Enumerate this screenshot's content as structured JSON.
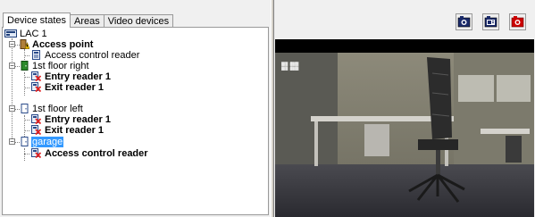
{
  "tabs": [
    {
      "label": "Device states",
      "active": true
    },
    {
      "label": "Areas",
      "active": false
    },
    {
      "label": "Video devices",
      "active": false
    }
  ],
  "tree": {
    "root": "LAC 1",
    "nodes": [
      {
        "label": "Access point",
        "bold": true,
        "icon": "warning-door-icon",
        "expander": "minus",
        "children": [
          {
            "label": "Access control reader",
            "bold": false,
            "icon": "reader-icon"
          }
        ]
      },
      {
        "label": "1st floor right",
        "bold": false,
        "icon": "green-door-icon",
        "expander": "minus",
        "children": [
          {
            "label": "Entry reader 1",
            "bold": true,
            "icon": "reader-error-icon"
          },
          {
            "label": "Exit reader 1",
            "bold": true,
            "icon": "reader-error-icon"
          }
        ]
      },
      {
        "label": "1st floor left",
        "bold": false,
        "icon": "door-icon",
        "expander": "minus",
        "children": [
          {
            "label": "Entry reader 1",
            "bold": true,
            "icon": "reader-error-icon"
          },
          {
            "label": "Exit reader 1",
            "bold": true,
            "icon": "reader-error-icon"
          }
        ]
      },
      {
        "label": "garage",
        "bold": false,
        "selected": true,
        "icon": "door-icon",
        "expander": "minus",
        "children": [
          {
            "label": "Access control reader",
            "bold": true,
            "icon": "reader-error-icon"
          }
        ]
      }
    ]
  },
  "toolbar": {
    "buttons": [
      {
        "name": "snapshot-button",
        "icon": "camera-snapshot-icon"
      },
      {
        "name": "record-button",
        "icon": "camera-record-icon"
      },
      {
        "name": "live-button",
        "icon": "camera-red-icon"
      }
    ]
  },
  "colors": {
    "selection": "#3399ff",
    "error_red": "#e02020",
    "door_green": "#2a8a2a",
    "warning_yellow": "#f0c000",
    "camera_red": "#cc0000"
  }
}
